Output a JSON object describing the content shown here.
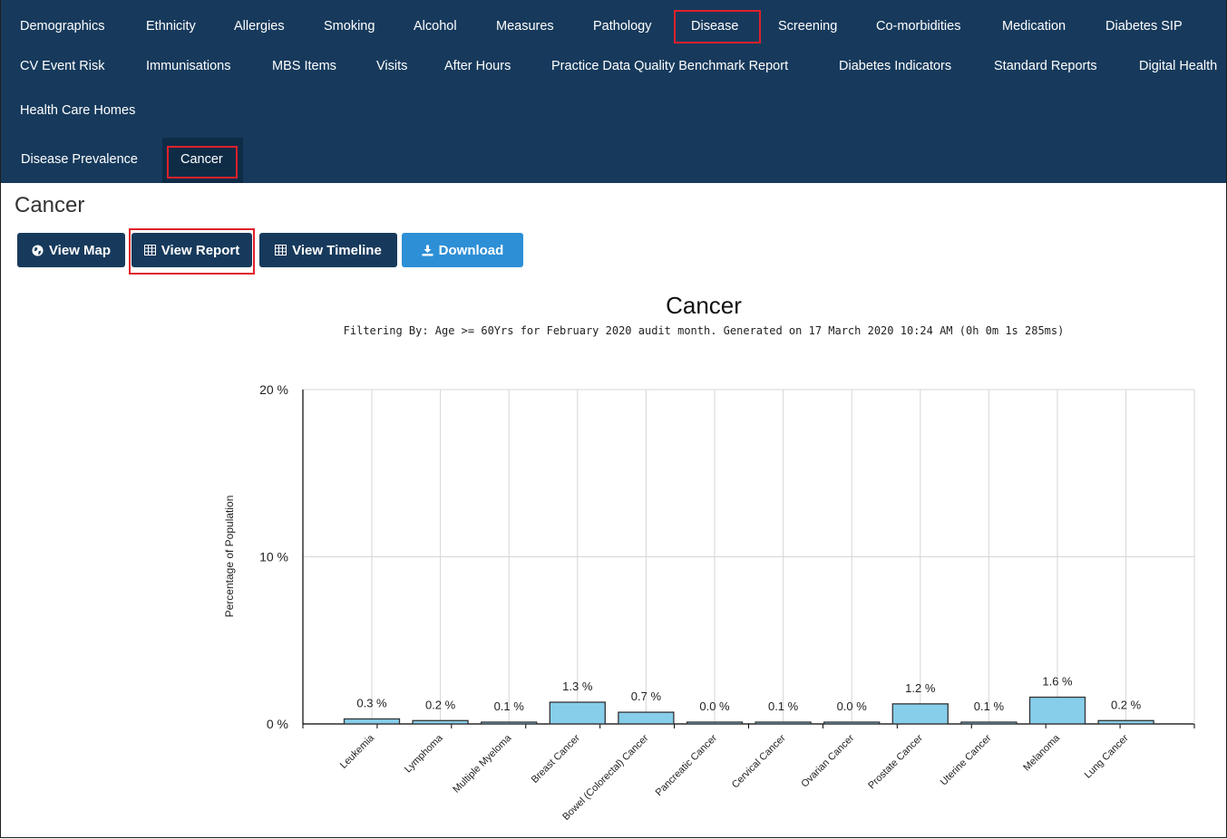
{
  "nav": {
    "row1": [
      "Demographics",
      "Ethnicity",
      "Allergies",
      "Smoking",
      "Alcohol",
      "Measures",
      "Pathology",
      "Disease",
      "Screening",
      "Co-morbidities",
      "Medication",
      "Diabetes SIP"
    ],
    "row2": [
      "CV Event Risk",
      "Immunisations",
      "MBS Items",
      "Visits",
      "After Hours",
      "Practice Data Quality Benchmark Report",
      "Diabetes Indicators",
      "Standard Reports",
      "Digital Health"
    ],
    "row3": [
      "Health Care Homes"
    ],
    "subtabs": [
      "Disease Prevalence",
      "Cancer"
    ],
    "active_main": "Disease",
    "active_sub": "Cancer"
  },
  "page": {
    "title": "Cancer"
  },
  "buttons": {
    "view_map": "View Map",
    "view_report": "View Report",
    "view_timeline": "View Timeline",
    "download": "Download"
  },
  "icons": {
    "view_map": "globe-icon",
    "view_report": "table-icon",
    "view_timeline": "table-icon",
    "download": "download-icon"
  },
  "colors": {
    "nav_bg": "#173a5c",
    "highlight": "#e0202a",
    "bar_fill": "#87ceeb",
    "download_btn": "#2d8fd6"
  },
  "chart_data": {
    "type": "bar",
    "title": "Cancer",
    "subtitle": "Filtering By:  Age >= 60Yrs for February 2020 audit month. Generated on 17 March 2020 10:24 AM (0h 0m 1s 285ms)",
    "ylabel": "Percentage of Population",
    "xlabel": "",
    "ylim": [
      0,
      20
    ],
    "yticks": [
      "0 %",
      "10 %",
      "20 %"
    ],
    "grid": true,
    "categories": [
      "Leukemia",
      "Lymphoma",
      "Multiple Myeloma",
      "Breast Cancer",
      "Bowel (Colorectal) Cancer",
      "Pancreatic Cancer",
      "Cervical Cancer",
      "Ovarian Cancer",
      "Prostate Cancer",
      "Uterine Cancer",
      "Melanoma",
      "Lung Cancer"
    ],
    "values": [
      0.3,
      0.2,
      0.1,
      1.3,
      0.7,
      0.0,
      0.1,
      0.0,
      1.2,
      0.1,
      1.6,
      0.2
    ],
    "data_labels": [
      "0.3 %",
      "0.2 %",
      "0.1 %",
      "1.3 %",
      "0.7 %",
      "0.0 %",
      "0.1 %",
      "0.0 %",
      "1.2 %",
      "0.1 %",
      "1.6 %",
      "0.2 %"
    ]
  }
}
